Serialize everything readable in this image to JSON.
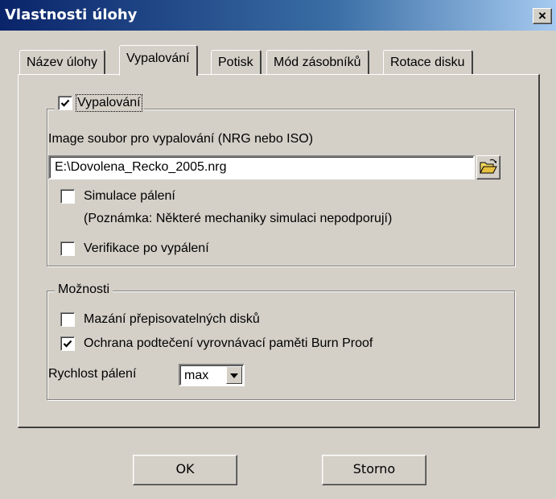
{
  "window": {
    "title": "Vlastnosti úlohy",
    "close_label": "×"
  },
  "tabs": [
    {
      "label": "Název úlohy",
      "active": false
    },
    {
      "label": "Vypalování",
      "active": true
    },
    {
      "label": "Potisk",
      "active": false
    },
    {
      "label": "Mód zásobníků",
      "active": false
    },
    {
      "label": "Rotace disku",
      "active": false
    }
  ],
  "burn_group": {
    "checkbox_label": "Vypalování",
    "checked": true,
    "image_label": "Image soubor pro vypalování (NRG nebo ISO)",
    "image_path": "E:\\Dovolena_Recko_2005.nrg",
    "browse_icon": "open-folder-icon",
    "simulate_label": "Simulace pálení",
    "simulate_checked": false,
    "simulate_note": "(Poznámka: Některé mechaniky simulaci nepodporují)",
    "verify_label": "Verifikace po vypálení",
    "verify_checked": false
  },
  "options_group": {
    "title": "Možnosti",
    "erase_label": "Mazání přepisovatelných disků",
    "erase_checked": false,
    "burnproof_label": "Ochrana podtečení vyrovnávací paměti Burn Proof",
    "burnproof_checked": true,
    "speed_label": "Rychlost pálení",
    "speed_value": "max"
  },
  "buttons": {
    "ok": "OK",
    "cancel": "Storno"
  },
  "colors": {
    "title_start": "#0a246a",
    "title_end": "#a6caf0",
    "face": "#d4d0c8"
  }
}
